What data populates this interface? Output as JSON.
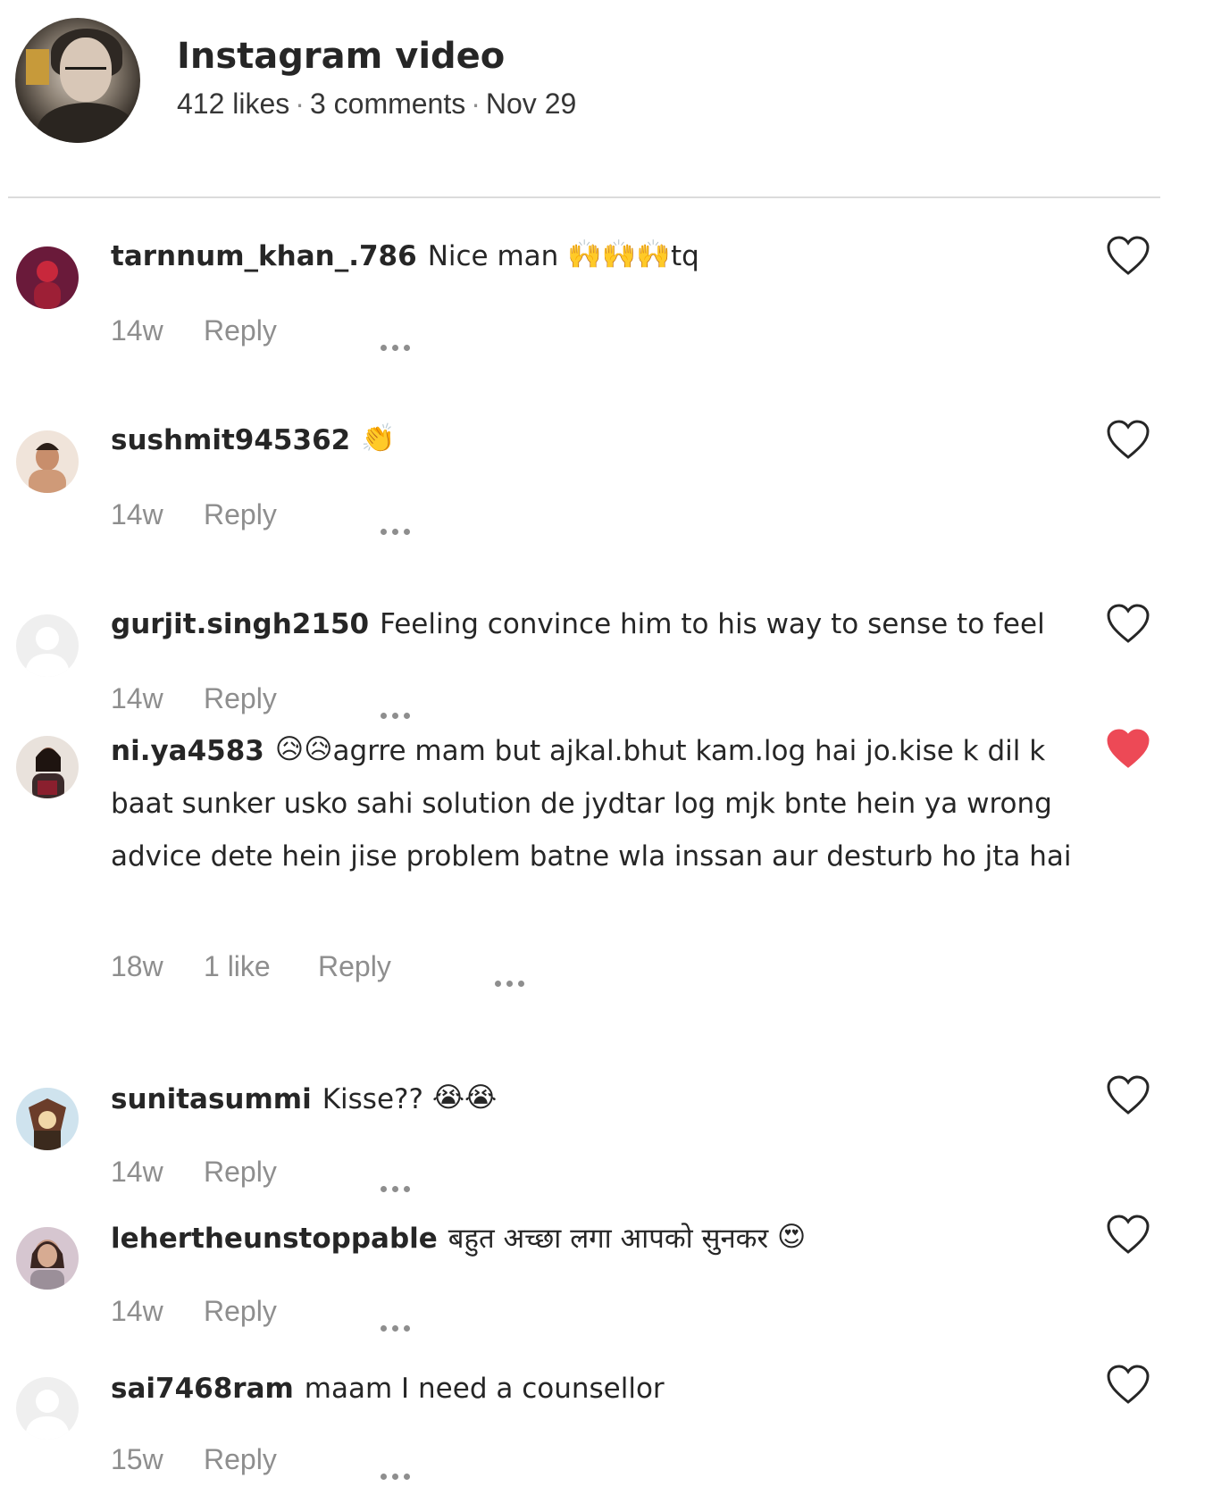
{
  "post": {
    "title": "Instagram video",
    "likes": "412 likes",
    "comments_count": "3 comments",
    "date": "Nov 29",
    "separator": "·"
  },
  "actions": {
    "reply_label": "Reply"
  },
  "comments": [
    {
      "username": "tarnnum_khan_.786",
      "text_before": "Nice man",
      "emojis": "🙌🙌🙌",
      "text_after": "tq",
      "age": "14w",
      "liked": false
    },
    {
      "username": "sushmit945362",
      "text_before": "",
      "emojis": "👏",
      "text_after": "",
      "age": "14w",
      "liked": false
    },
    {
      "username": "gurjit.singh2150",
      "text_before": "Feeling convince him to his way to sense to feel",
      "emojis": "",
      "text_after": "",
      "age": "14w",
      "liked": false
    },
    {
      "username": "ni.ya4583",
      "text_before": "",
      "emojis": "😥😥",
      "text_after": "agrre mam but ajkal.bhut kam.log hai jo.kise k dil k baat sunker usko sahi solution de jydtar log mjk bnte hein ya wrong advice dete hein jise problem batne wla inssan aur desturb ho jta hai",
      "age": "18w",
      "likes": "1 like",
      "liked": true
    },
    {
      "username": "sunitasummi",
      "text_before": "Kisse??",
      "emojis": "😭😭",
      "text_after": "",
      "age": "14w",
      "liked": false
    },
    {
      "username": "lehertheunstoppable",
      "text_before": "बहुत अच्छा लगा आपको सुनकर",
      "emojis": "😍",
      "text_after": "",
      "age": "14w",
      "liked": false
    },
    {
      "username": "sai7468ram",
      "text_before": "maam I need a counsellor",
      "emojis": "",
      "text_after": "",
      "age": "15w",
      "liked": false
    }
  ],
  "colors": {
    "text": "#262626",
    "muted": "#8e8e8e",
    "like_red": "#ed4956",
    "divider": "#dbdbdb"
  }
}
